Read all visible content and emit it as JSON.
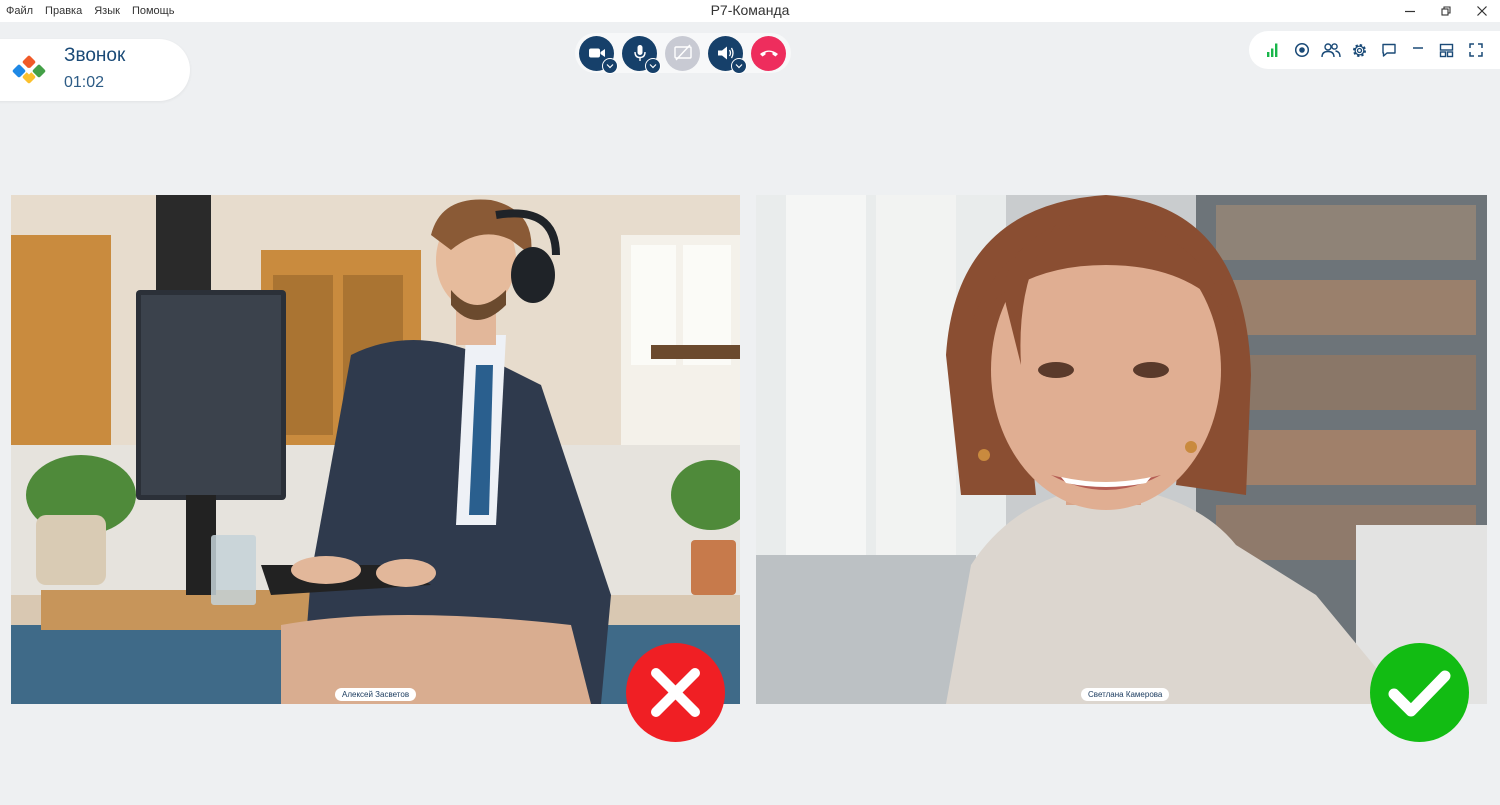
{
  "app": {
    "title": "Р7-Команда"
  },
  "menu": {
    "items": [
      "Файл",
      "Правка",
      "Язык",
      "Помощь"
    ]
  },
  "window_controls": {
    "icons": [
      "minimize-icon",
      "restore-icon",
      "close-icon"
    ]
  },
  "call": {
    "title": "Звонок",
    "duration": "01:02"
  },
  "controls": {
    "buttons": [
      {
        "name": "camera",
        "icon": "camera-icon",
        "state": "on",
        "has_menu": true
      },
      {
        "name": "microphone",
        "icon": "microphone-icon",
        "state": "on",
        "has_menu": true
      },
      {
        "name": "screen-share",
        "icon": "screen-share-off-icon",
        "state": "disabled",
        "has_menu": false
      },
      {
        "name": "speaker",
        "icon": "speaker-icon",
        "state": "on",
        "has_menu": true
      },
      {
        "name": "hang-up",
        "icon": "phone-hangup-icon",
        "state": "danger",
        "has_menu": false
      }
    ],
    "colors": {
      "primary": "#16406a",
      "disabled": "#c8cad3",
      "danger": "#ee2d5d"
    }
  },
  "toolbar": {
    "icons": [
      "signal-strength-icon",
      "record-icon",
      "participants-icon",
      "settings-icon",
      "chat-icon",
      "minimize-call-icon",
      "layout-icon",
      "fullscreen-icon"
    ],
    "signal_color": "#19b64a"
  },
  "participants": [
    {
      "name": "Алексей Засветов",
      "status": "rejected",
      "status_icon": "cross-icon",
      "status_color": "#f01f24"
    },
    {
      "name": "Светлана Камерова",
      "status": "approved",
      "status_icon": "checkmark-icon",
      "status_color": "#12bc13"
    }
  ]
}
